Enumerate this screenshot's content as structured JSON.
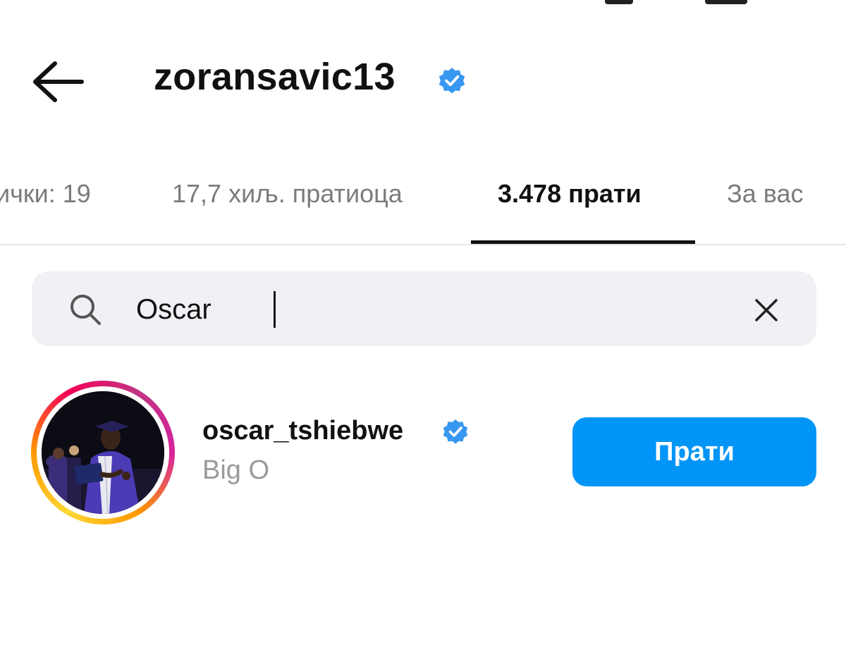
{
  "header": {
    "title": "zoransavic13",
    "back_icon": "arrow-left-icon",
    "verified_icon": "verified-badge-icon"
  },
  "tabs": [
    {
      "label": "ички: 19",
      "active": false
    },
    {
      "label": "17,7 хиљ. пратиоца",
      "active": false
    },
    {
      "label": "3.478 прати",
      "active": true
    },
    {
      "label": "За вас",
      "active": false
    }
  ],
  "search": {
    "value": "Oscar",
    "icon": "search-icon",
    "clear_icon": "close-icon"
  },
  "results": [
    {
      "username": "oscar_tshiebwe",
      "full_name": "Big O",
      "verified": true,
      "button_label": "Прати"
    }
  ],
  "colors": {
    "accent": "#0095f6",
    "verified": "#3897f0",
    "search_bg": "#eff1f4",
    "muted_text": "#7b7b7b"
  }
}
